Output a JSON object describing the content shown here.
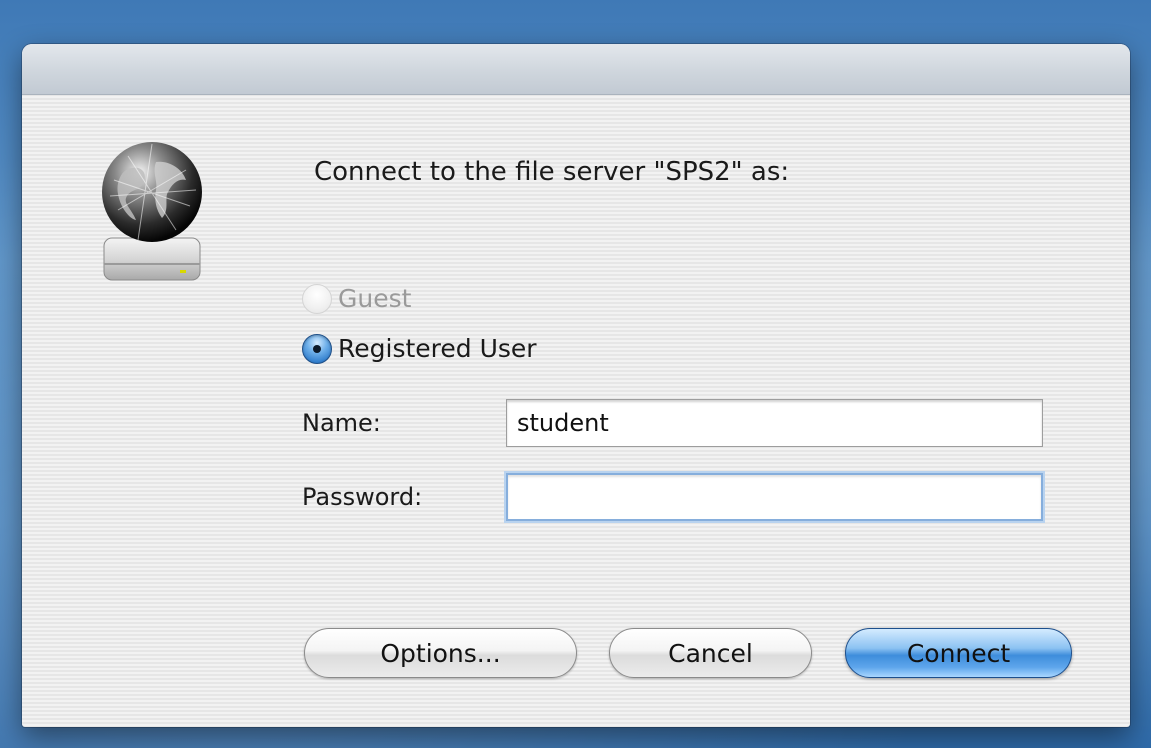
{
  "dialog": {
    "prompt": "Connect to the file server \"SPS2\" as:",
    "icon": "network-server-globe-icon"
  },
  "login_type": {
    "options": [
      {
        "label": "Guest",
        "selected": false,
        "enabled": false
      },
      {
        "label": "Registered User",
        "selected": true,
        "enabled": true
      }
    ]
  },
  "fields": {
    "name_label": "Name:",
    "name_value": "student",
    "password_label": "Password:",
    "password_value": ""
  },
  "buttons": {
    "options_label": "Options...",
    "cancel_label": "Cancel",
    "connect_label": "Connect"
  },
  "colors": {
    "accent": "#3e8ddb",
    "desktop": "#4a86c0"
  }
}
